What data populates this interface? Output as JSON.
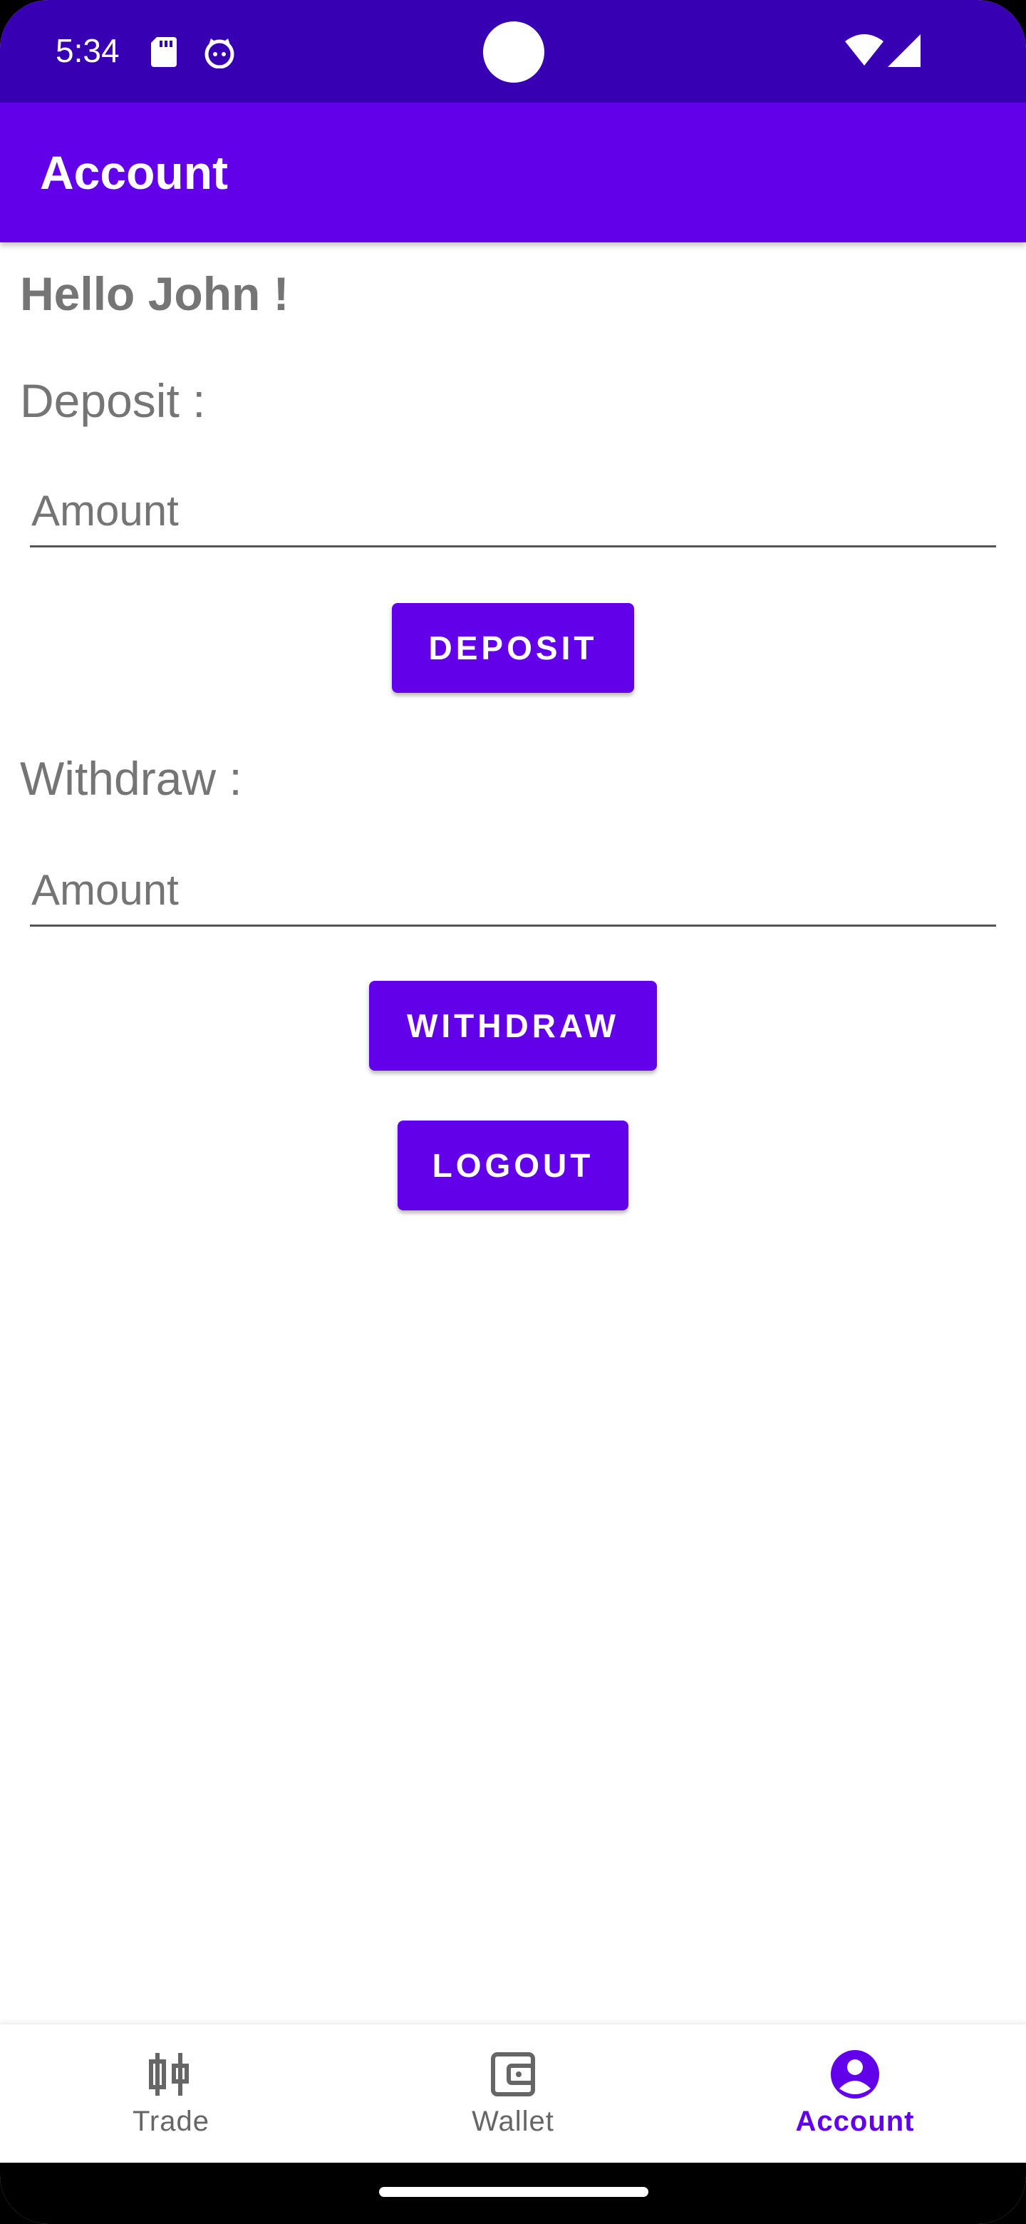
{
  "status_bar": {
    "time": "5:34",
    "icons": [
      "sd-card-icon",
      "cat-icon",
      "wifi-icon",
      "signal-icon"
    ]
  },
  "app_bar": {
    "title": "Account",
    "color": "#6200ea"
  },
  "content": {
    "greeting": "Hello John !",
    "deposit": {
      "label": "Deposit :",
      "input_placeholder": "Amount",
      "input_value": "",
      "button_label": "DEPOSIT"
    },
    "withdraw": {
      "label": "Withdraw :",
      "input_placeholder": "Amount",
      "input_value": "",
      "button_label": "WITHDRAW"
    },
    "logout_label": "LOGOUT"
  },
  "bottom_nav": {
    "items": [
      {
        "label": "Trade",
        "icon": "candlestick-icon",
        "active": false
      },
      {
        "label": "Wallet",
        "icon": "wallet-icon",
        "active": false
      },
      {
        "label": "Account",
        "icon": "account-circle-icon",
        "active": true
      }
    ]
  },
  "colors": {
    "status_bar": "#3700b3",
    "primary": "#6200ea",
    "text_secondary": "#757575"
  }
}
